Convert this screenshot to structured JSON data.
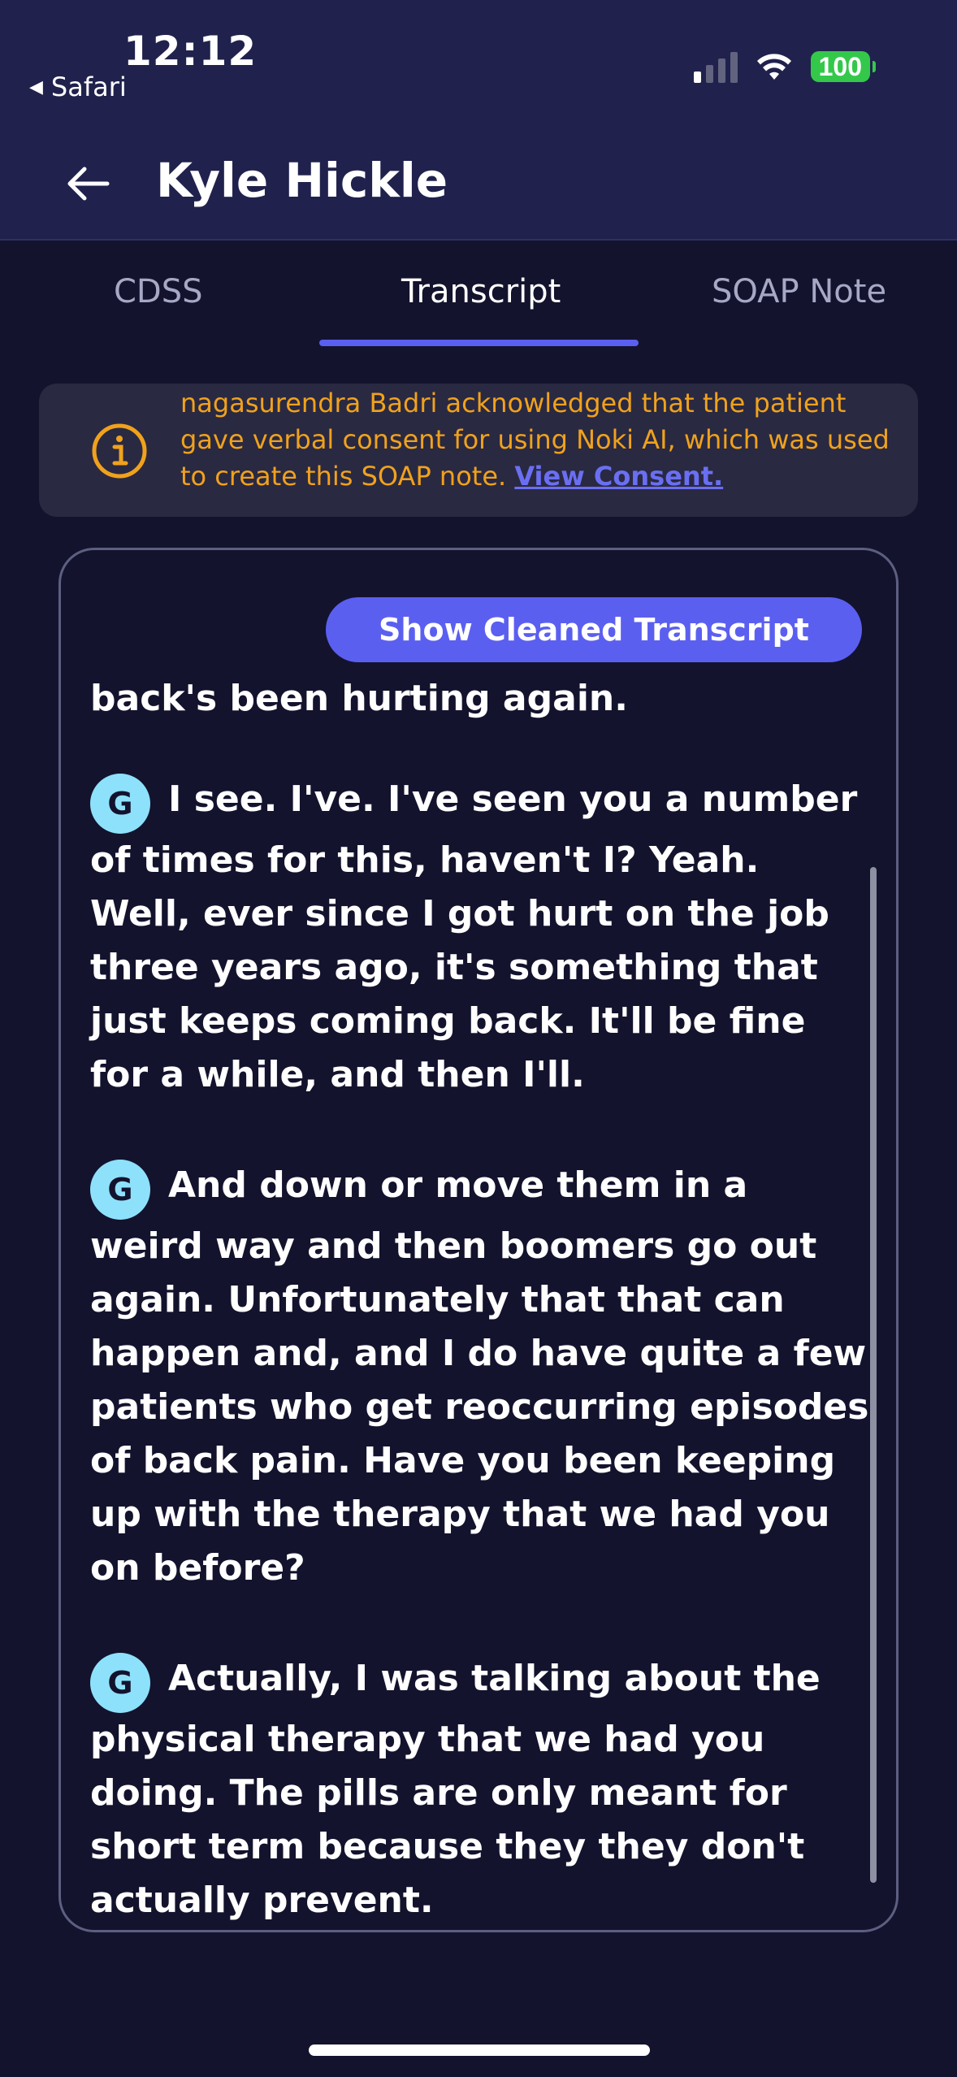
{
  "status_bar": {
    "time": "12:12",
    "back_app": "Safari",
    "battery": "100"
  },
  "header": {
    "title": "Kyle Hickle"
  },
  "tabs": [
    {
      "label": "CDSS",
      "active": false
    },
    {
      "label": "Transcript",
      "active": true
    },
    {
      "label": "SOAP Note",
      "active": false
    }
  ],
  "consent_banner": {
    "text": "nagasurendra Badri acknowledged that the patient gave verbal consent for using Noki AI, which was used to create this SOAP note.",
    "link_text": "View Consent."
  },
  "transcript": {
    "button_label": "Show Cleaned Transcript",
    "speaker_initial": "G",
    "entries": [
      {
        "has_avatar": false,
        "text": "back's been hurting again."
      },
      {
        "has_avatar": true,
        "text": "I see. I've. I've seen you a number of times for this, haven't I? Yeah. Well, ever since I got hurt on the job three years ago, it's something that just keeps coming back. It'll be fine for a while, and then I'll."
      },
      {
        "has_avatar": true,
        "text": "And down or move them in a weird way and then boomers go out again. Unfortunately that that can happen and, and I do have quite a few patients who get reoccurring episodes of back pain. Have you been keeping up with the therapy that we had you on before?"
      },
      {
        "has_avatar": true,
        "text": "Actually, I was talking about the physical therapy that we had you doing. The pills are only meant for short term because they they don't actually prevent."
      }
    ]
  },
  "colors": {
    "accent": "#5b5ff0",
    "warning_text": "#f0a21c",
    "avatar_bg": "#8ee1fb",
    "header_bg": "#20224d",
    "page_bg": "#13132e"
  },
  "icons": {
    "back": "arrow-left-icon",
    "info": "info-circle-icon",
    "signal": "cellular-signal-icon",
    "wifi": "wifi-icon",
    "battery": "battery-icon"
  }
}
